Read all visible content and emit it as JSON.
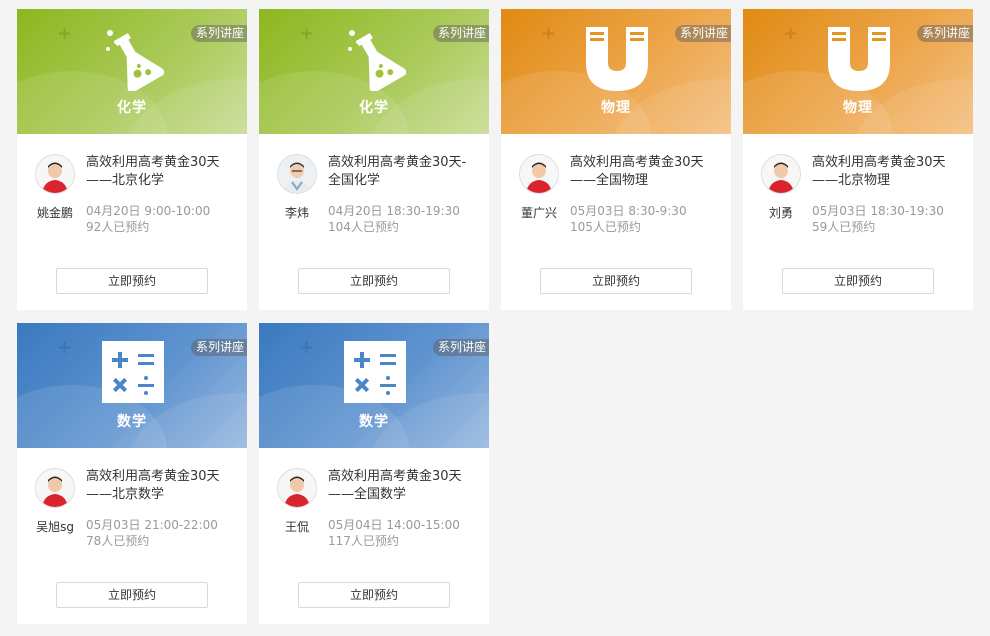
{
  "cards": [
    {
      "tag": "系列讲座",
      "subject": "化学",
      "subject_icon": "flask-icon",
      "title_line1": "高效利用高考黄金30天",
      "title_line2": "——北京化学",
      "teacher": "姚金鹏",
      "time": "04月20日  9:00-10:00",
      "booked": "92人已预约",
      "button": "立即预约"
    },
    {
      "tag": "系列讲座",
      "subject": "化学",
      "subject_icon": "flask-icon",
      "title_line1": "高效利用高考黄金30天-",
      "title_line2": "全国化学",
      "teacher": "李炜",
      "time": "04月20日  18:30-19:30",
      "booked": "104人已预约",
      "button": "立即预约"
    },
    {
      "tag": "系列讲座",
      "subject": "物理",
      "subject_icon": "magnet-icon",
      "title_line1": "高效利用高考黄金30天",
      "title_line2": "——全国物理",
      "teacher": "董广兴",
      "time": "05月03日  8:30-9:30",
      "booked": "105人已预约",
      "button": "立即预约"
    },
    {
      "tag": "系列讲座",
      "subject": "物理",
      "subject_icon": "magnet-icon",
      "title_line1": "高效利用高考黄金30天",
      "title_line2": "——北京物理",
      "teacher": "刘勇",
      "time": "05月03日  18:30-19:30",
      "booked": "59人已预约",
      "button": "立即预约"
    },
    {
      "tag": "系列讲座",
      "subject": "数学",
      "subject_icon": "math-operators-icon",
      "title_line1": "高效利用高考黄金30天",
      "title_line2": "——北京数学",
      "teacher": "吴旭sg",
      "time": "05月03日  21:00-22:00",
      "booked": "78人已预约",
      "button": "立即预约"
    },
    {
      "tag": "系列讲座",
      "subject": "数学",
      "subject_icon": "math-operators-icon",
      "title_line1": "高效利用高考黄金30天",
      "title_line2": "——全国数学",
      "teacher": "王侃",
      "time": "05月04日  14:00-15:00",
      "booked": "117人已预约",
      "button": "立即预约"
    }
  ],
  "colors": {
    "chemistry": "#8db71f",
    "physics": "#e08a12",
    "math": "#3a79c0",
    "page_bg": "#f4f4f4"
  }
}
